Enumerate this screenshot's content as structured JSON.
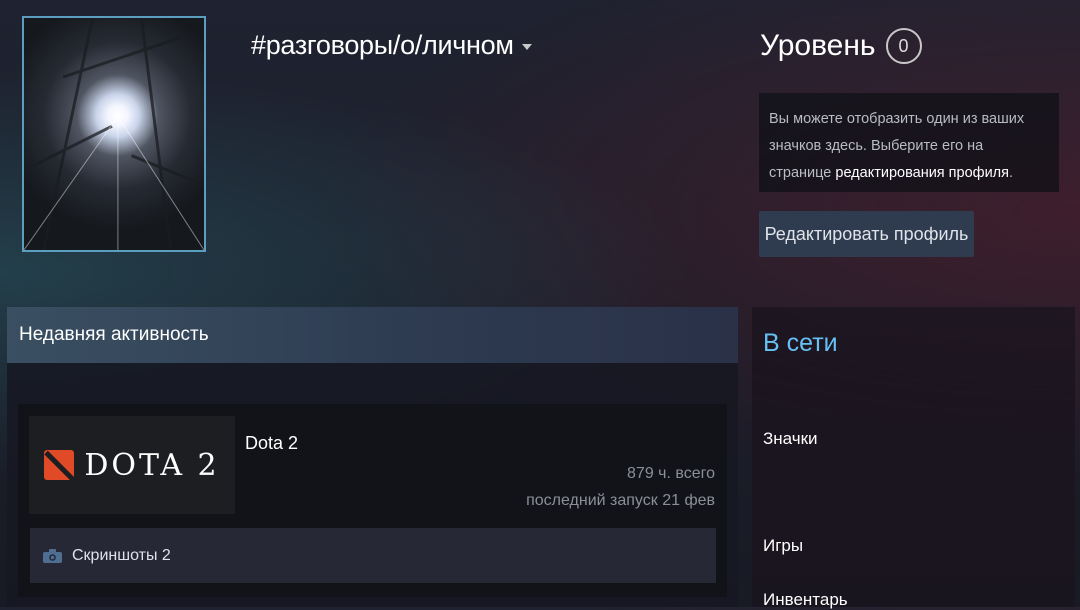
{
  "profile": {
    "persona_name": "#разговоры/о/личном",
    "level_label": "Уровень",
    "level_value": "0"
  },
  "badge_box": {
    "text_before": "Вы можете отобразить один из ваших значков здесь. Выберите его на странице ",
    "link_text": "редактирования профиля",
    "text_after": "."
  },
  "buttons": {
    "edit_profile": "Редактировать профиль"
  },
  "activity": {
    "header": "Недавняя активность",
    "game": {
      "logo_text": "DOTA 2",
      "name": "Dota 2",
      "hours": "879 ч. всего",
      "last_played": "последний запуск 21 фев",
      "screenshots": "Скриншоты 2"
    }
  },
  "sidebar": {
    "status": "В сети",
    "links": [
      "Значки",
      "Игры",
      "Инвентарь"
    ]
  },
  "colors": {
    "accent_online": "#66c0f4",
    "avatar_border": "#5c9ec0",
    "dota_red": "#e04a26"
  }
}
